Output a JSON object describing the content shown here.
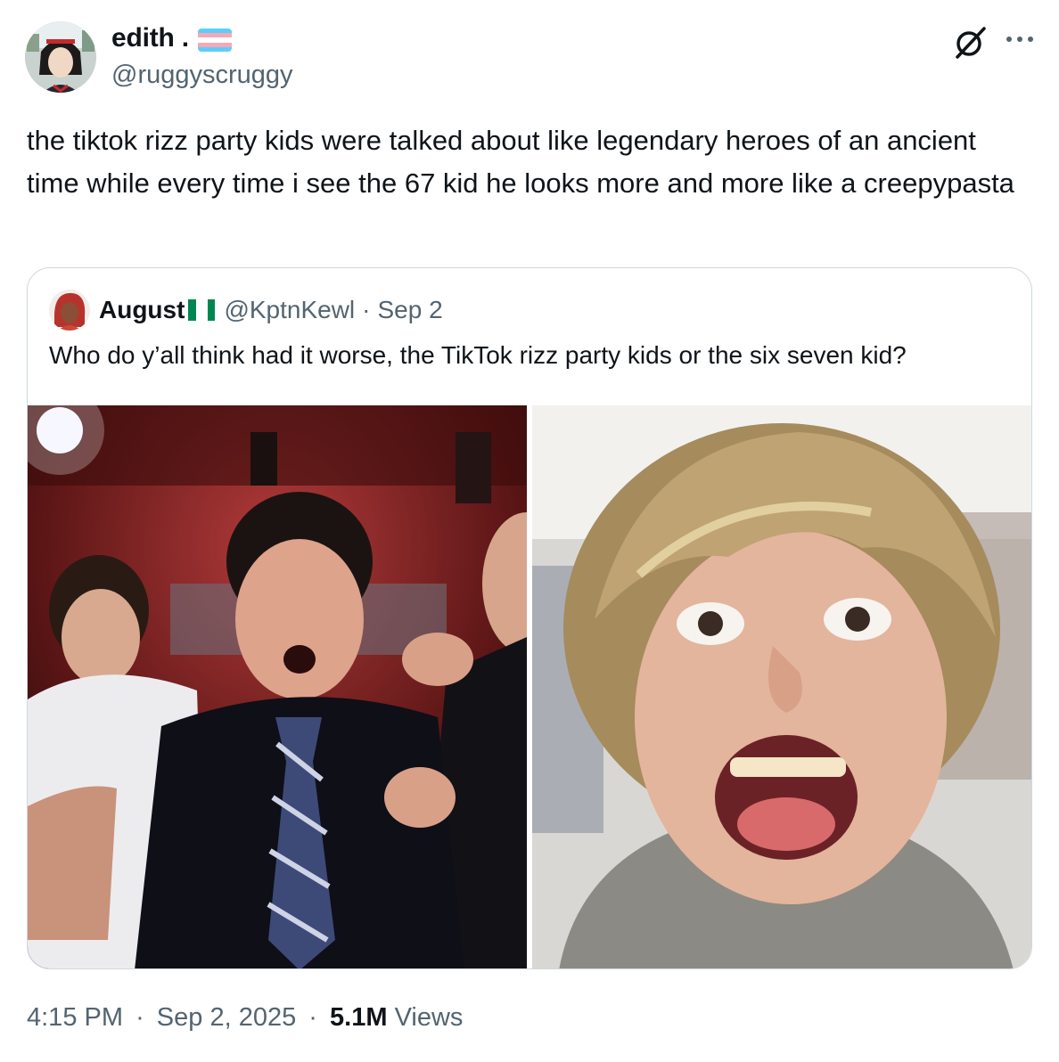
{
  "author": {
    "name": "edith .",
    "handle": "@ruggyscruggy",
    "flag_colors": [
      "#5BCEFA",
      "#F5A9B8",
      "#FFFFFF",
      "#F5A9B8",
      "#5BCEFA"
    ]
  },
  "tweet": {
    "text": "the tiktok rizz party kids were talked about like legendary heroes of an ancient time while every time i see the 67 kid he looks more and more like a creepypasta"
  },
  "icons": {
    "grok": "grok-slash-icon",
    "more": "more-dots-icon"
  },
  "quote": {
    "name": "August",
    "handle": "@KptnKewl",
    "separator": "·",
    "date": "Sep 2",
    "flag_colors": [
      "#008751",
      "#FFFFFF",
      "#008751"
    ],
    "text": "Who do y’all think had it worse, the TikTok rizz party kids or the six seven kid?",
    "media": [
      {
        "kind": "photo",
        "subject": "party-kids-photo"
      },
      {
        "kind": "photo",
        "subject": "six-seven-kid-photo"
      }
    ]
  },
  "footer": {
    "time": "4:15 PM",
    "sep1": "·",
    "date": "Sep 2, 2025",
    "sep2": "·",
    "views_count": "5.1M",
    "views_label": "Views"
  },
  "colors": {
    "text": "#0f1419",
    "muted": "#536471",
    "border": "#cfd9de"
  }
}
